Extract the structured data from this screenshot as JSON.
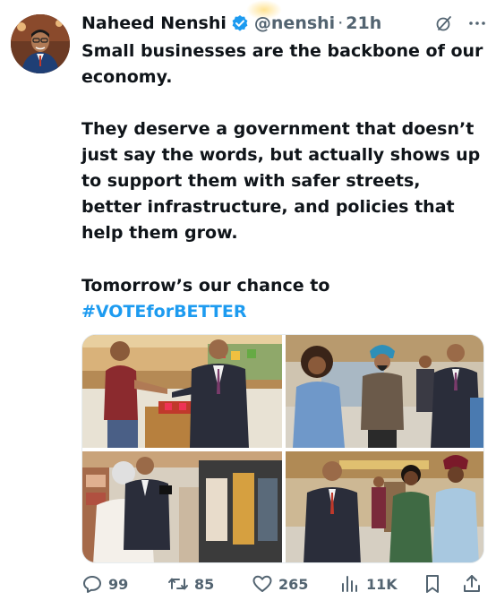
{
  "tweet": {
    "author_name": "Naheed Nenshi",
    "handle": "@nenshi",
    "separator": "·",
    "time": "21h",
    "paragraph1": "Small businesses are the backbone of our economy.",
    "paragraph2": "They deserve a government that doesn’t just say the words, but actually shows up to support them with safer streets, better infrastructure, and policies that help them grow.",
    "paragraph3_text": "Tomorrow’s our chance to",
    "hashtag": "#VOTEforBETTER",
    "icons": {
      "verified": "verified-badge-icon",
      "grok": "grok-icon",
      "more": "more-icon"
    },
    "colors": {
      "accent": "#1d9bf0",
      "text": "#0f1419",
      "muted": "#536471"
    }
  },
  "actions": {
    "reply_count": "99",
    "retweet_count": "85",
    "like_count": "265",
    "views_count": "11K"
  }
}
